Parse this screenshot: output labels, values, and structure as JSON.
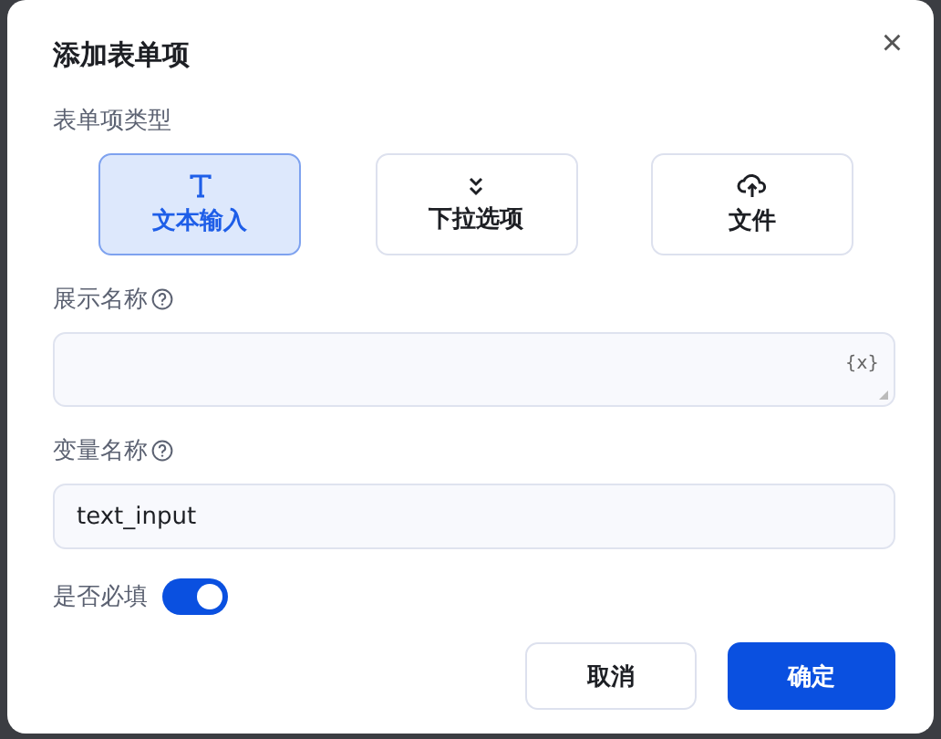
{
  "dialog": {
    "title": "添加表单项",
    "close": "×"
  },
  "type_section": {
    "label": "表单项类型",
    "options": [
      {
        "kind": "text",
        "label": "文本输入",
        "selected": true
      },
      {
        "kind": "select",
        "label": "下拉选项",
        "selected": false
      },
      {
        "kind": "file",
        "label": "文件",
        "selected": false
      }
    ]
  },
  "display_name": {
    "label": "展示名称",
    "variable_token": "{x}"
  },
  "variable_name": {
    "label": "变量名称",
    "value": "text_input"
  },
  "required": {
    "label": "是否必填",
    "on": true
  },
  "buttons": [
    {
      "kind": "secondary",
      "label": "取消"
    },
    {
      "kind": "primary",
      "label": "确定"
    }
  ]
}
